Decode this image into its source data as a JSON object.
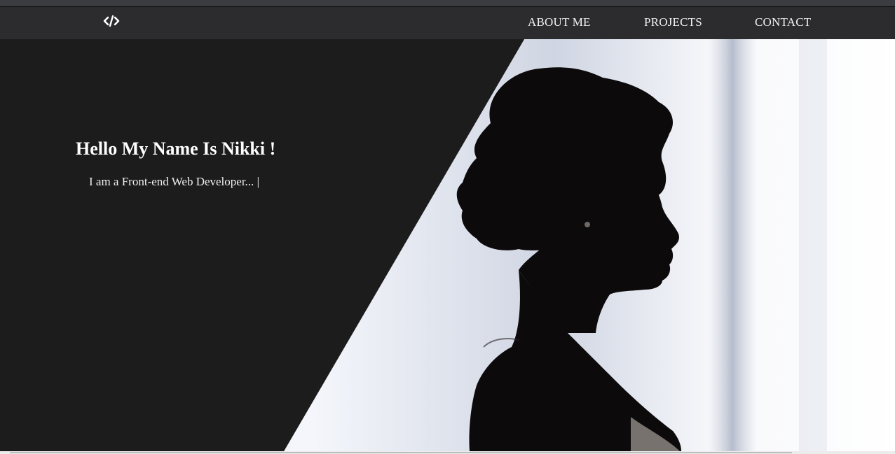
{
  "nav": {
    "logo_icon": "code-icon",
    "links": [
      {
        "label": "ABOUT ME"
      },
      {
        "label": "PROJECTS"
      },
      {
        "label": "CONTACT"
      }
    ]
  },
  "hero": {
    "title": "Hello My Name Is Nikki !",
    "subtitle": "I am a Front-end Web Developer...",
    "caret": "|",
    "image_icon": "portrait-photo"
  },
  "colors": {
    "background": "#1c1c1c",
    "navbar": "#2c2c2e",
    "text": "#ffffff"
  }
}
